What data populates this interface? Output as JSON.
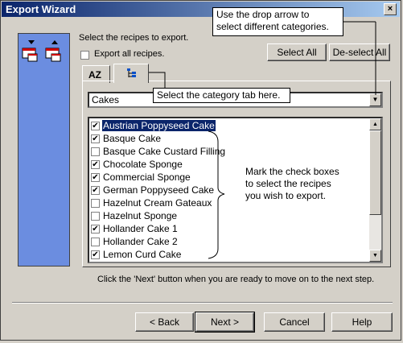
{
  "window": {
    "title": "Export Wizard",
    "close_glyph": "×"
  },
  "instructions": {
    "select": "Select the recipes to export.",
    "export_all": "Export all recipes.",
    "export_all_checked": false
  },
  "buttons": {
    "select_all": "Select All",
    "deselect_all": "De-select All"
  },
  "tabs": [
    {
      "name": "alphabetical-tab",
      "icon": "sort-az-icon",
      "label": "AZ"
    },
    {
      "name": "category-tab",
      "icon": "tree-icon",
      "active": true
    }
  ],
  "category_combo": {
    "value": "Cakes"
  },
  "recipes": [
    {
      "label": "Austrian Poppyseed Cake",
      "checked": true,
      "selected": true
    },
    {
      "label": "Basque Cake",
      "checked": true
    },
    {
      "label": "Basque Cake Custard Filling",
      "checked": false
    },
    {
      "label": "Chocolate Sponge",
      "checked": true
    },
    {
      "label": "Commercial Sponge",
      "checked": true
    },
    {
      "label": "German Poppyseed Cake",
      "checked": true
    },
    {
      "label": "Hazelnut Cream Gateaux",
      "checked": false
    },
    {
      "label": "Hazelnut Sponge",
      "checked": false
    },
    {
      "label": "Hollander Cake 1",
      "checked": true
    },
    {
      "label": "Hollander Cake 2",
      "checked": false
    },
    {
      "label": "Lemon Curd Cake",
      "checked": true
    }
  ],
  "callouts": {
    "drop_arrow_line1": "Use the drop arrow to",
    "drop_arrow_line2": "select different categories.",
    "category_tab": "Select the category tab here.",
    "checkbox_line1": "Mark the check boxes",
    "checkbox_line2": "to select the recipes",
    "checkbox_line3": "you wish to export."
  },
  "footer_hint": "Click the 'Next' button when you are ready to move on to the next step.",
  "nav": {
    "back": "< Back",
    "next": "Next >",
    "cancel": "Cancel",
    "help": "Help"
  },
  "colors": {
    "title_start": "#0a246a",
    "title_end": "#a6caf0",
    "panel": "#6b8de0",
    "selection": "#0a246a"
  }
}
